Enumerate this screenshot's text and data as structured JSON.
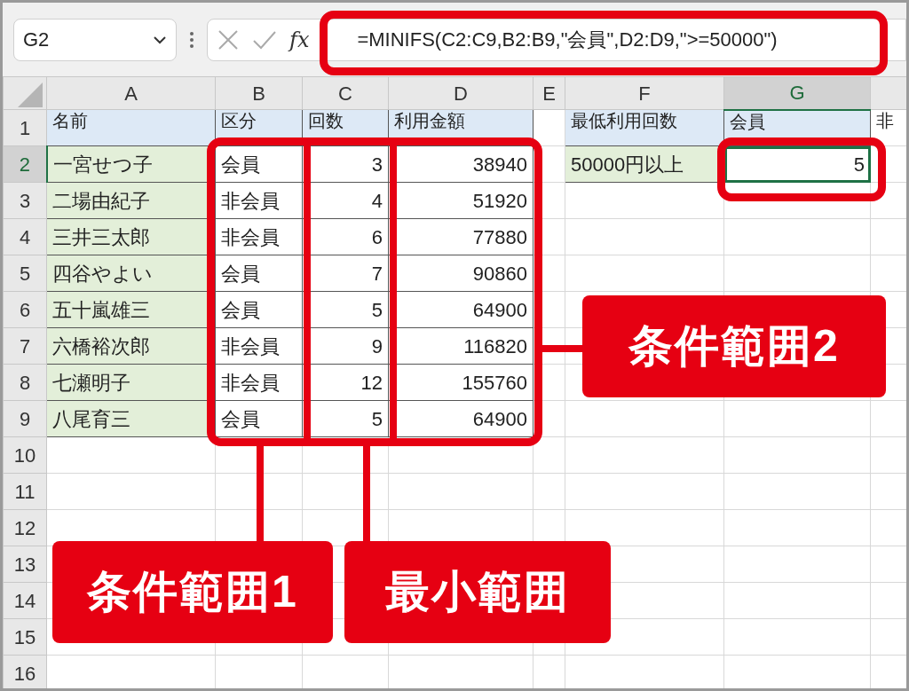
{
  "name_box": {
    "value": "G2"
  },
  "formula_bar": {
    "fx": "fx",
    "formula": "=MINIFS(C2:C9,B2:B9,\"会員\",D2:D9,\">=50000\")"
  },
  "columns": [
    {
      "label": "A",
      "selected": false
    },
    {
      "label": "B",
      "selected": false
    },
    {
      "label": "C",
      "selected": false
    },
    {
      "label": "D",
      "selected": false
    },
    {
      "label": "E",
      "selected": false
    },
    {
      "label": "F",
      "selected": false
    },
    {
      "label": "G",
      "selected": true
    }
  ],
  "rows": [
    {
      "label": "1",
      "selected": false,
      "cells": [
        {
          "kind": "header",
          "text": "名前"
        },
        {
          "kind": "header",
          "text": "区分"
        },
        {
          "kind": "header",
          "text": "回数"
        },
        {
          "kind": "header",
          "text": "利用金額"
        },
        {
          "kind": "blank"
        },
        {
          "kind": "header",
          "text": "最低利用回数"
        },
        {
          "kind": "header",
          "text": "会員"
        },
        {
          "kind": "plain",
          "text": "非"
        }
      ]
    },
    {
      "label": "2",
      "selected": true,
      "cells": [
        {
          "kind": "label",
          "text": "一宮せつ子"
        },
        {
          "kind": "text",
          "text": "会員"
        },
        {
          "kind": "number",
          "text": "3"
        },
        {
          "kind": "number",
          "text": "38940"
        },
        {
          "kind": "blank"
        },
        {
          "kind": "label",
          "text": "50000円以上"
        },
        {
          "kind": "number",
          "text": "5"
        },
        {
          "kind": "blank"
        }
      ]
    },
    {
      "label": "3",
      "selected": false,
      "cells": [
        {
          "kind": "label",
          "text": "二場由紀子"
        },
        {
          "kind": "text",
          "text": "非会員"
        },
        {
          "kind": "number",
          "text": "4"
        },
        {
          "kind": "number",
          "text": "51920"
        }
      ]
    },
    {
      "label": "4",
      "selected": false,
      "cells": [
        {
          "kind": "label",
          "text": "三井三太郎"
        },
        {
          "kind": "text",
          "text": "非会員"
        },
        {
          "kind": "number",
          "text": "6"
        },
        {
          "kind": "number",
          "text": "77880"
        }
      ]
    },
    {
      "label": "5",
      "selected": false,
      "cells": [
        {
          "kind": "label",
          "text": "四谷やよい"
        },
        {
          "kind": "text",
          "text": "会員"
        },
        {
          "kind": "number",
          "text": "7"
        },
        {
          "kind": "number",
          "text": "90860"
        }
      ]
    },
    {
      "label": "6",
      "selected": false,
      "cells": [
        {
          "kind": "label",
          "text": "五十嵐雄三"
        },
        {
          "kind": "text",
          "text": "会員"
        },
        {
          "kind": "number",
          "text": "5"
        },
        {
          "kind": "number",
          "text": "64900"
        }
      ]
    },
    {
      "label": "7",
      "selected": false,
      "cells": [
        {
          "kind": "label",
          "text": "六橋裕次郎"
        },
        {
          "kind": "text",
          "text": "非会員"
        },
        {
          "kind": "number",
          "text": "9"
        },
        {
          "kind": "number",
          "text": "116820"
        }
      ]
    },
    {
      "label": "8",
      "selected": false,
      "cells": [
        {
          "kind": "label",
          "text": "七瀬明子"
        },
        {
          "kind": "text",
          "text": "非会員"
        },
        {
          "kind": "number",
          "text": "12"
        },
        {
          "kind": "number",
          "text": "155760"
        }
      ]
    },
    {
      "label": "9",
      "selected": false,
      "cells": [
        {
          "kind": "label",
          "text": "八尾育三"
        },
        {
          "kind": "text",
          "text": "会員"
        },
        {
          "kind": "number",
          "text": "5"
        },
        {
          "kind": "number",
          "text": "64900"
        }
      ]
    },
    {
      "label": "10",
      "selected": false,
      "cells": []
    },
    {
      "label": "11",
      "selected": false,
      "cells": []
    },
    {
      "label": "12",
      "selected": false,
      "cells": []
    },
    {
      "label": "13",
      "selected": false,
      "cells": []
    },
    {
      "label": "14",
      "selected": false,
      "cells": []
    },
    {
      "label": "15",
      "selected": false,
      "cells": []
    },
    {
      "label": "16",
      "selected": false,
      "cells": []
    }
  ],
  "callouts": [
    {
      "text": "条件範囲2"
    },
    {
      "text": "条件範囲1"
    },
    {
      "text": "最小範囲"
    }
  ]
}
